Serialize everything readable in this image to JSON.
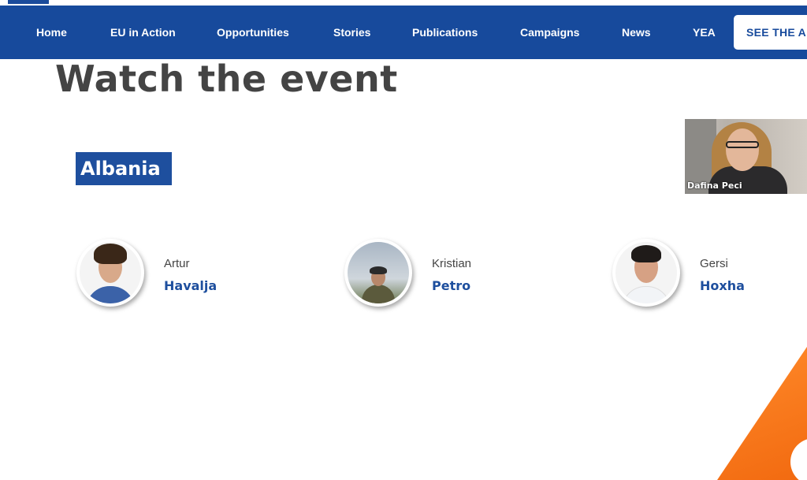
{
  "nav": {
    "items": [
      "Home",
      "EU in Action",
      "Opportunities",
      "Stories",
      "Publications",
      "Campaigns",
      "News",
      "YEA"
    ],
    "cta": "SEE THE APP"
  },
  "main": {
    "heading": "Watch the event",
    "country": "Albania",
    "video_caption": "Dafina Peci",
    "participants": [
      {
        "first": "Artur",
        "last": "Havalja"
      },
      {
        "first": "Kristian",
        "last": "Petro"
      },
      {
        "first": "Gersi",
        "last": "Hoxha"
      }
    ]
  },
  "colors": {
    "brand_blue": "#174a9c",
    "accent_orange": "#f26a10",
    "heading_gray": "#444444"
  }
}
